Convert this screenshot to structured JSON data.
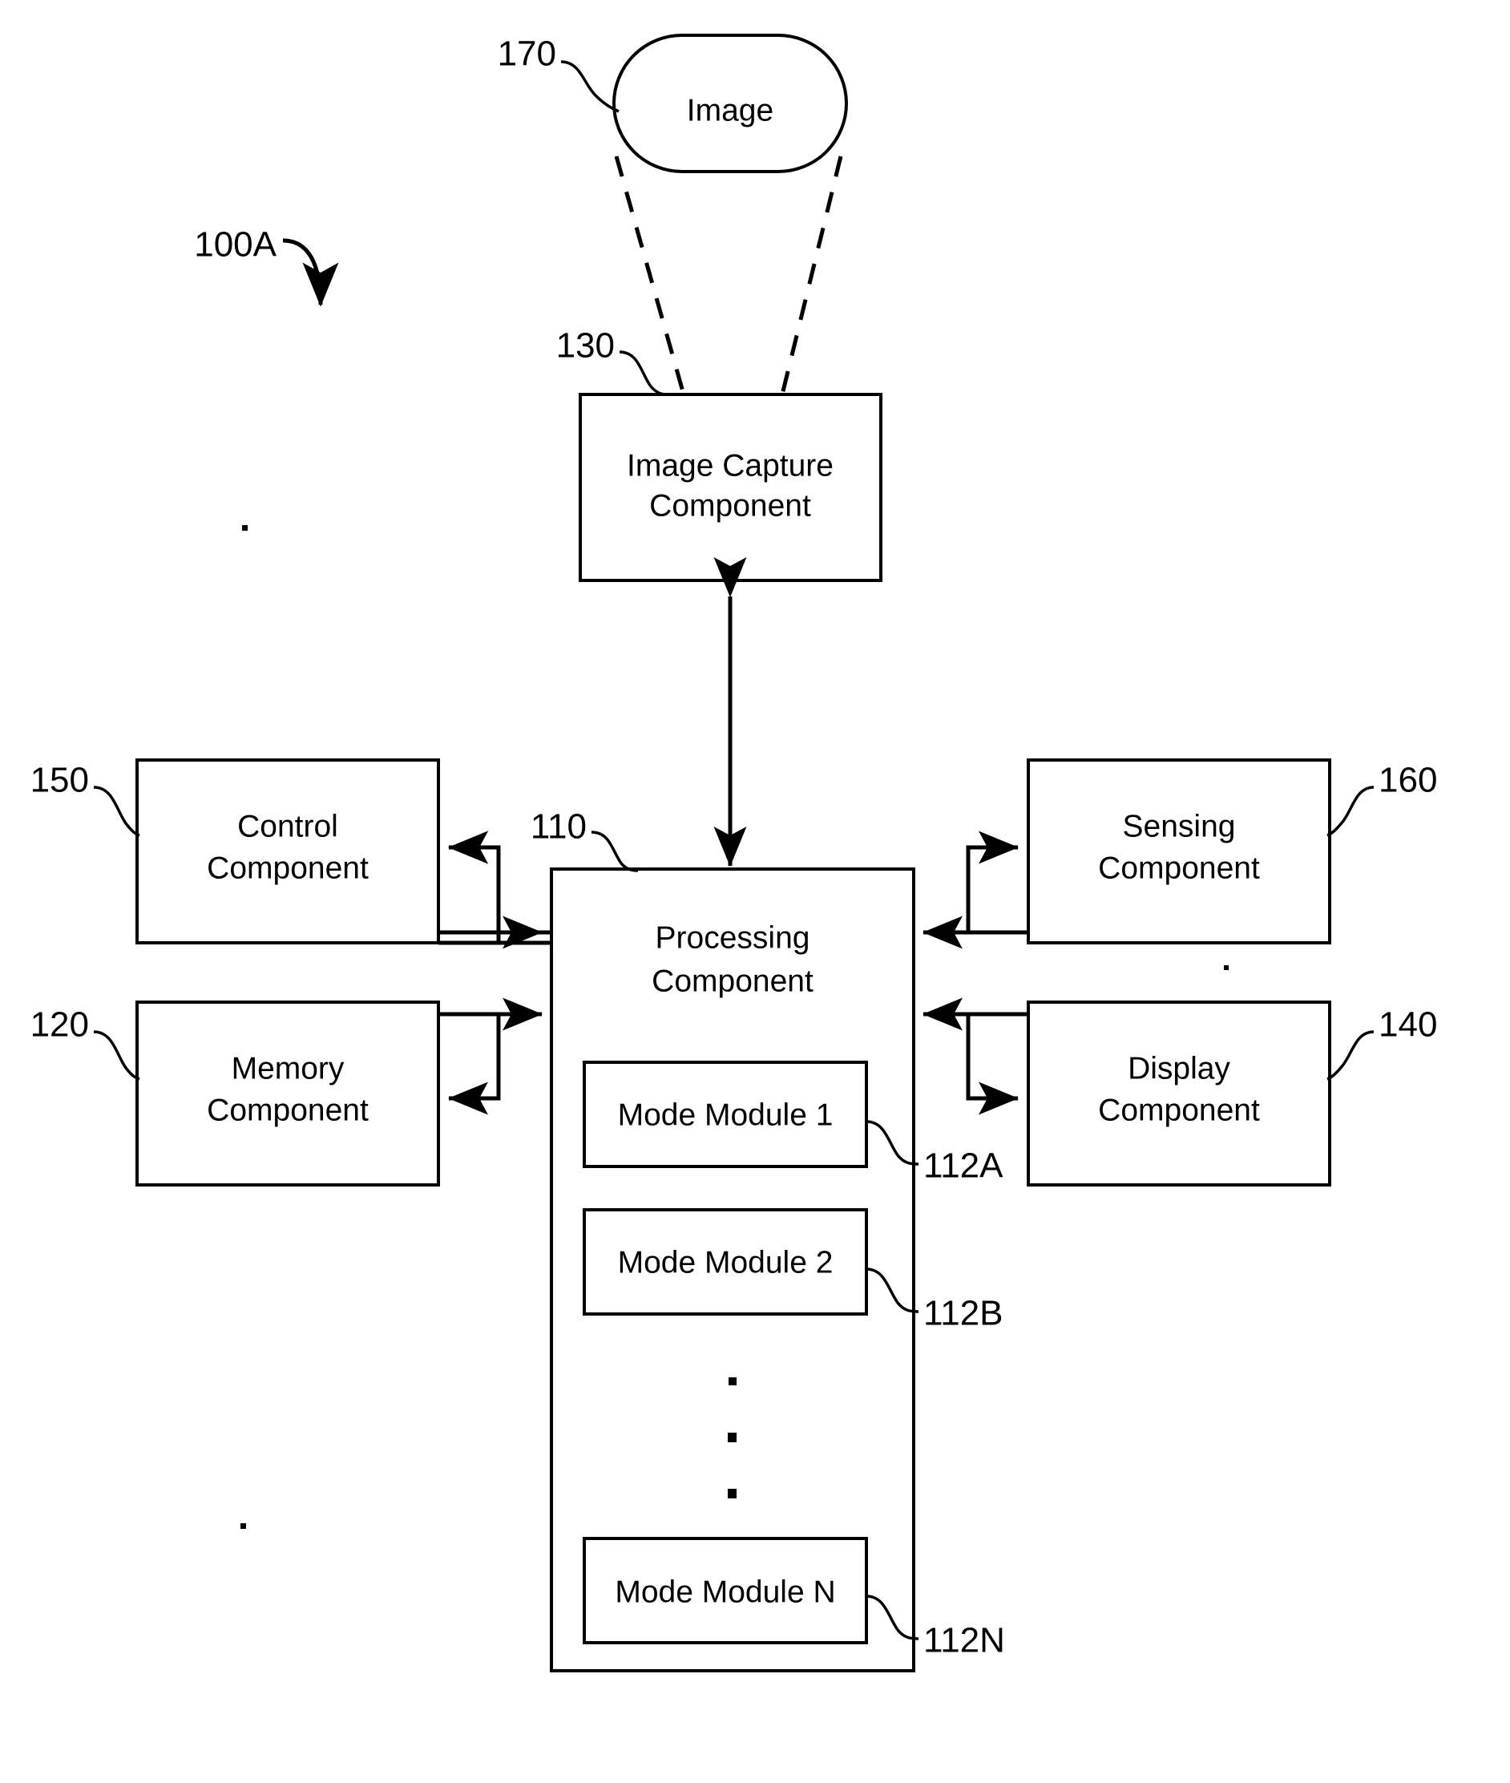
{
  "figure": {
    "label": "100A",
    "kind": "patent-block-diagram"
  },
  "nodes": {
    "image": {
      "label": "Image",
      "ref": "170"
    },
    "image_capture": {
      "label_line1": "Image Capture",
      "label_line2": "Component",
      "ref": "130"
    },
    "processing": {
      "label_line1": "Processing",
      "label_line2": "Component",
      "ref": "110"
    },
    "control": {
      "label_line1": "Control",
      "label_line2": "Component",
      "ref": "150"
    },
    "memory": {
      "label_line1": "Memory",
      "label_line2": "Component",
      "ref": "120"
    },
    "sensing": {
      "label_line1": "Sensing",
      "label_line2": "Component",
      "ref": "160"
    },
    "display": {
      "label_line1": "Display",
      "label_line2": "Component",
      "ref": "140"
    }
  },
  "modules": [
    {
      "label": "Mode Module 1",
      "ref": "112A"
    },
    {
      "label": "Mode Module 2",
      "ref": "112B"
    },
    {
      "label": "Mode Module N",
      "ref": "112N"
    }
  ],
  "colors": {
    "ink": "#000000",
    "paper": "#ffffff"
  }
}
